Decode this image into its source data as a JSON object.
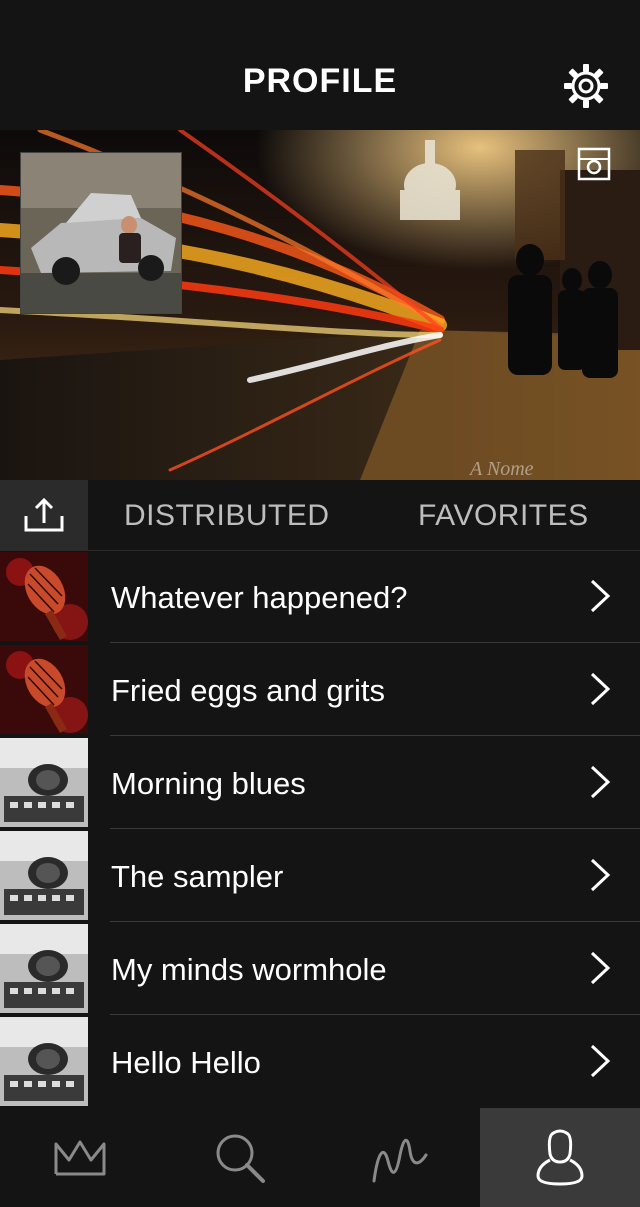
{
  "header": {
    "title": "PROFILE",
    "settings_icon": "gear-icon"
  },
  "cover": {
    "photo_icon": "camera-icon",
    "watermark": "A Nome"
  },
  "tabs": {
    "upload_icon": "upload-icon",
    "items": [
      {
        "label": "DISTRIBUTED"
      },
      {
        "label": "FAVORITES"
      }
    ]
  },
  "tracks": [
    {
      "title": "Whatever happened?",
      "thumb": "red-microphone"
    },
    {
      "title": "Fried eggs and grits",
      "thumb": "red-microphone"
    },
    {
      "title": "Morning blues",
      "thumb": "gray-sampler"
    },
    {
      "title": "The sampler",
      "thumb": "gray-sampler"
    },
    {
      "title": "My minds wormhole",
      "thumb": "gray-sampler"
    },
    {
      "title": "Hello Hello",
      "thumb": "gray-sampler"
    }
  ],
  "bottom_nav": [
    {
      "icon": "crown-icon",
      "active": false
    },
    {
      "icon": "search-icon",
      "active": false
    },
    {
      "icon": "waveform-icon",
      "active": false
    },
    {
      "icon": "profile-icon",
      "active": true
    }
  ],
  "colors": {
    "background": "#141414",
    "active_tab": "#3a3a3a",
    "divider": "#3a3a3a",
    "tab_text": "#bdbdbd"
  }
}
